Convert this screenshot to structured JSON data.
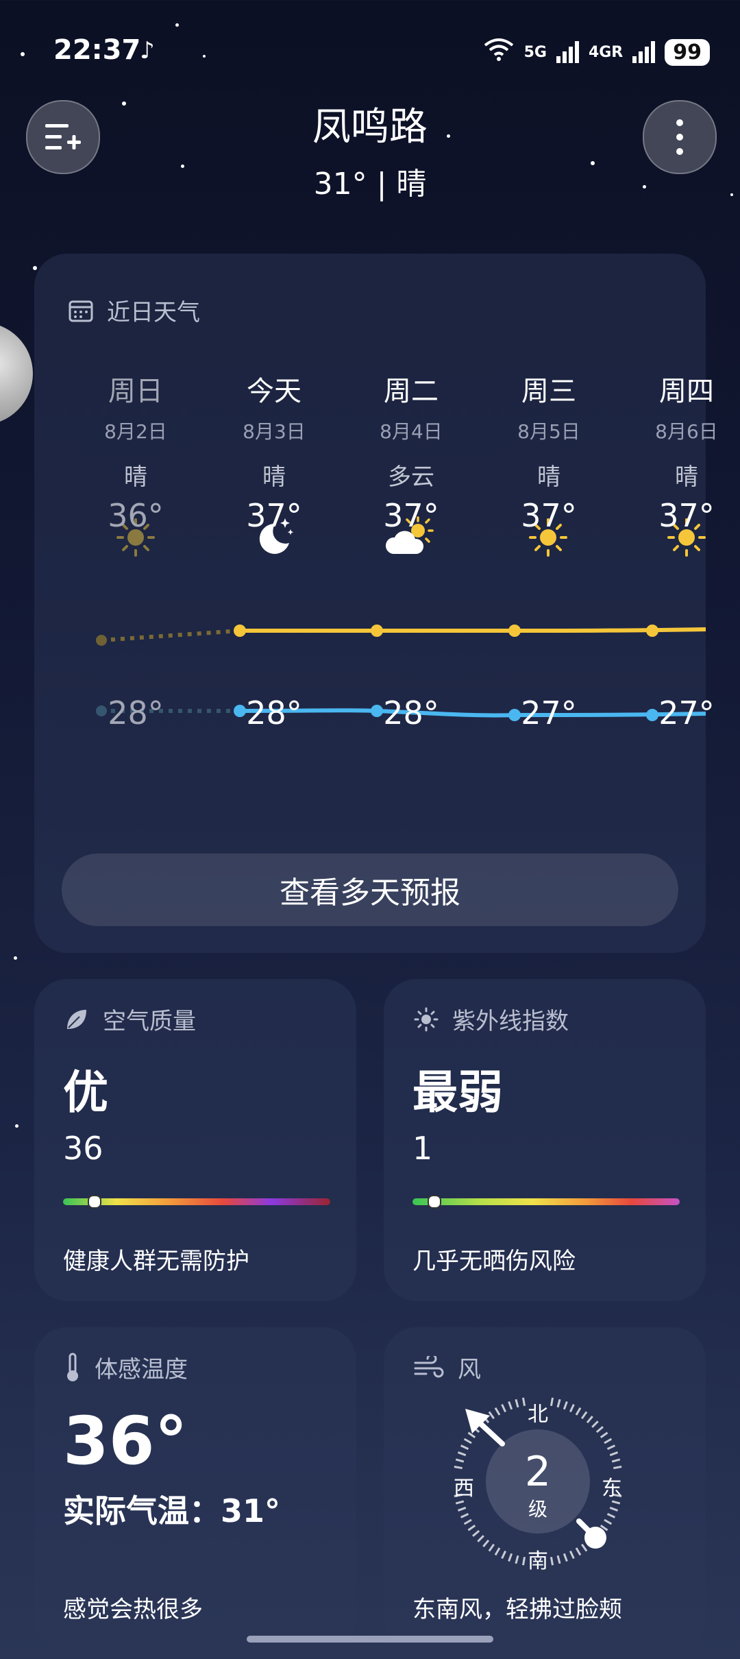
{
  "status": {
    "time": "22:37",
    "tiktok_icon": "tiktok-icon",
    "net1": "5G",
    "net2": "4GR",
    "wifi_badge": "7",
    "battery": "99"
  },
  "header": {
    "city": "凤鸣路",
    "summary": "31° | 晴"
  },
  "forecast": {
    "title": "近日天气",
    "days": [
      {
        "name": "周日",
        "date": "8月2日",
        "cond": "晴",
        "icon": "sun-icon",
        "high": "36°",
        "low": "28°"
      },
      {
        "name": "今天",
        "date": "8月3日",
        "cond": "晴",
        "icon": "moon-stars-icon",
        "high": "37°",
        "low": "28°"
      },
      {
        "name": "周二",
        "date": "8月4日",
        "cond": "多云",
        "icon": "partly-cloudy-icon",
        "high": "37°",
        "low": "28°"
      },
      {
        "name": "周三",
        "date": "8月5日",
        "cond": "晴",
        "icon": "sun-icon",
        "high": "37°",
        "low": "27°"
      },
      {
        "name": "周四",
        "date": "8月6日",
        "cond": "晴",
        "icon": "sun-icon",
        "high": "37°",
        "low": "27°"
      }
    ],
    "button": "查看多天预报",
    "colors": {
      "high_line": "#f5c63a",
      "low_line": "#4ab7f0"
    }
  },
  "air": {
    "title": "空气质量",
    "level": "优",
    "value": "36",
    "advice": "健康人群无需防护",
    "position": 0.12
  },
  "uv": {
    "title": "紫外线指数",
    "level": "最弱",
    "value": "1",
    "advice": "几乎无晒伤风险",
    "position": 0.08
  },
  "feels": {
    "title": "体感温度",
    "temp": "36°",
    "actual": "实际气温：31°",
    "advice": "感觉会热很多"
  },
  "wind": {
    "title": "风",
    "level": "2",
    "unit": "级",
    "north": "北",
    "south": "南",
    "east": "东",
    "west": "西",
    "advice": "东南风，轻拂过脸颊"
  }
}
